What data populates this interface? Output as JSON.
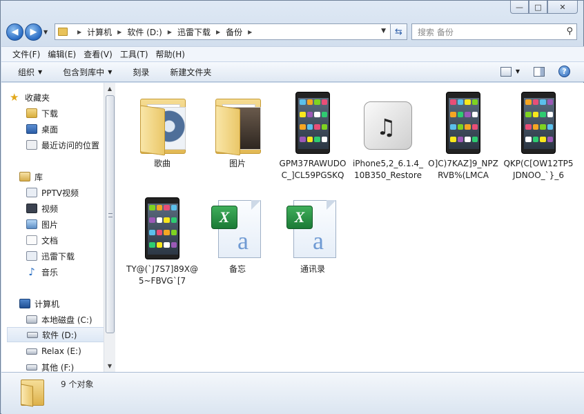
{
  "window": {
    "caption": {
      "minimize": "—",
      "maximize": "□",
      "close": "✕"
    }
  },
  "nav": {
    "back": "◀",
    "forward": "▶",
    "breadcrumb": [
      "计算机",
      "软件 (D:)",
      "迅雷下载",
      "备份"
    ],
    "search_placeholder": "搜索 备份"
  },
  "menu": [
    "文件(F)",
    "编辑(E)",
    "查看(V)",
    "工具(T)",
    "帮助(H)"
  ],
  "toolbar": {
    "organize": "组织",
    "include_in_library": "包含到库中",
    "burn": "刻录",
    "new_folder": "新建文件夹",
    "help": "?"
  },
  "sidebar": {
    "favorites": {
      "label": "收藏夹",
      "items": [
        "下载",
        "桌面",
        "最近访问的位置"
      ]
    },
    "libraries": {
      "label": "库",
      "items": [
        "PPTV视频",
        "视频",
        "图片",
        "文档",
        "迅雷下载",
        "音乐"
      ]
    },
    "computer": {
      "label": "计算机",
      "items": [
        "本地磁盘 (C:)",
        "软件 (D:)",
        "Relax (E:)",
        "其他 (F:)"
      ]
    }
  },
  "files": [
    {
      "name": "歌曲",
      "type": "folder"
    },
    {
      "name": "图片",
      "type": "folder"
    },
    {
      "name": "GPM37RAWUDOC_]CL59PGSKQ",
      "type": "image"
    },
    {
      "name": "iPhone5,2_6.1.4_10B350_Restore",
      "type": "restore"
    },
    {
      "name": "O]C)7KAZ]9_NPZRVB%(LMCA",
      "type": "image"
    },
    {
      "name": "QKP(C[OW12TP5JDNOO_`}_6",
      "type": "image"
    },
    {
      "name": "TY@(`J7S7]89X@5~FBVG`[7",
      "type": "image"
    },
    {
      "name": "备忘",
      "type": "excel"
    },
    {
      "name": "通讯录",
      "type": "excel"
    }
  ],
  "details": {
    "count": "9 个对象"
  }
}
